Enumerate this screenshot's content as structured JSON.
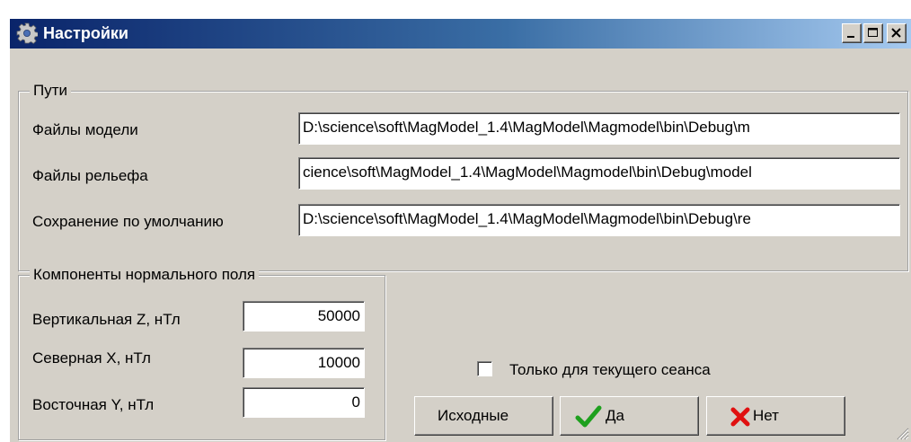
{
  "window": {
    "title": "Настройки",
    "minimize_icon": "minimize-icon",
    "maximize_icon": "maximize-icon",
    "close_icon": "close-icon"
  },
  "paths": {
    "legend": "Пути",
    "model_files_label": "Файлы модели",
    "model_files_value": "D:\\science\\soft\\MagModel_1.4\\MagModel\\Magmodel\\bin\\Debug\\m",
    "relief_files_label": "Файлы рельефа",
    "relief_files_value": "cience\\soft\\MagModel_1.4\\MagModel\\Magmodel\\bin\\Debug\\model",
    "default_save_label": "Сохранение по умолчанию",
    "default_save_value": "D:\\science\\soft\\MagModel_1.4\\MagModel\\Magmodel\\bin\\Debug\\re"
  },
  "field_components": {
    "legend": "Компоненты нормального поля",
    "vertical_label": "Вертикальная Z, нТл",
    "vertical_value": "50000",
    "north_label": "Северная X, нТл",
    "north_value": "10000",
    "east_label": "Восточная Y, нТл",
    "east_value": "0"
  },
  "session_only": {
    "label": "Только для текущего сеанса",
    "checked": false
  },
  "buttons": {
    "defaults_label": "Исходные",
    "ok_label": "Да",
    "cancel_label": "Нет"
  },
  "colors": {
    "titlebar_start": "#0a246a",
    "titlebar_end": "#a6caf0",
    "face": "#d4d0c8",
    "ok_check": "#1ea01e",
    "cancel_x": "#e01010"
  }
}
